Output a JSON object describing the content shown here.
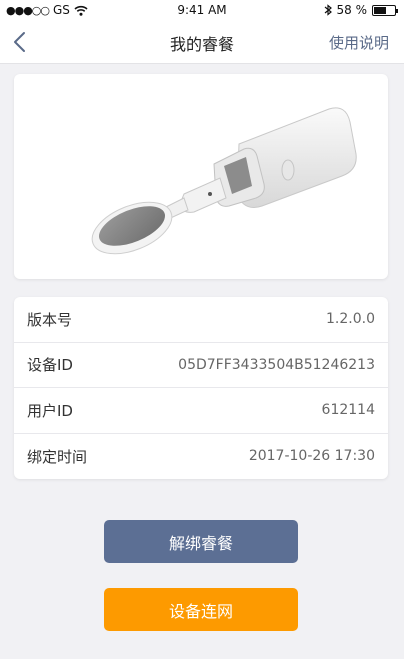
{
  "status_bar": {
    "signal": "●●●○○",
    "carrier": "GS",
    "wifi_icon": "wifi-icon",
    "time": "9:41 AM",
    "bluetooth_icon": "bluetooth-icon",
    "battery_text": "58 %",
    "battery_level": 0.58
  },
  "nav": {
    "back_icon": "chevron-left-icon",
    "title": "我的睿餐",
    "help_label": "使用说明"
  },
  "info": [
    {
      "label": "版本号",
      "value": "1.2.0.0"
    },
    {
      "label": "设备ID",
      "value": "05D7FF3433504B51246213"
    },
    {
      "label": "用户ID",
      "value": "612114"
    },
    {
      "label": "绑定时间",
      "value": "2017-10-26 17:30"
    }
  ],
  "buttons": {
    "unbind_label": "解绑睿餐",
    "network_label": "设备连网"
  },
  "colors": {
    "unbind_button": "#5c6f94",
    "network_button": "#fd9a00",
    "help_link": "#5a6a88"
  }
}
